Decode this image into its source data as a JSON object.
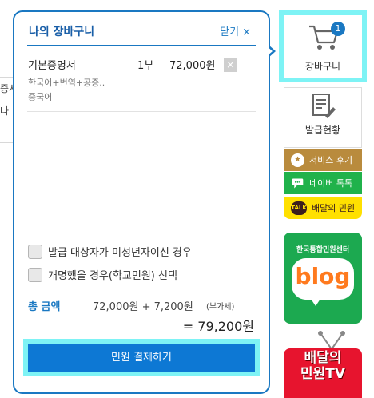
{
  "background": {
    "fragments": [
      "증서",
      "나"
    ]
  },
  "cart": {
    "title": "나의 장바구니",
    "close_label": "닫기",
    "close_icon": "×",
    "item": {
      "name": "기본증명서",
      "quantity": "1부",
      "price": "72,000원",
      "remove_icon": "×",
      "options_line1": "한국어+번역+공증..",
      "options_line2": "중국어"
    },
    "checkboxes": [
      {
        "label": "발급 대상자가 미성년자이신 경우",
        "checked": false
      },
      {
        "label": "개명했을 경우(학교민원) 선택",
        "checked": false
      }
    ],
    "total": {
      "label": "총 금액",
      "calculation": "72,000원 + 7,200원",
      "vat_note": "(부가세)",
      "final": "= 79,200원"
    },
    "pay_button": "민원 결제하기"
  },
  "quick_menu": {
    "cart": {
      "label": "장바구니",
      "badge": "1",
      "icon": "cart-icon"
    },
    "issue_status": {
      "label": "발급현황",
      "icon": "document-edit-icon"
    },
    "review": {
      "label": "서비스 후기",
      "icon": "star-icon"
    },
    "naver_talk": {
      "label": "네이버 톡톡",
      "icon": "chat-bubble-icon"
    },
    "kakao": {
      "label": "배달의 민원",
      "icon_text": "TALK"
    },
    "blog": {
      "title": "한국통합민원센터",
      "word": "blog"
    },
    "tv": {
      "line1": "배달의",
      "line2": "민원TV"
    }
  },
  "colors": {
    "accent": "#1a78c2",
    "highlight": "#7ef3f5",
    "pay_button": "#0d78d4",
    "review": "#b98b3d",
    "naver": "#20b24b",
    "kakao": "#ffe000",
    "blog": "#1ca950",
    "tv": "#e7142e"
  }
}
